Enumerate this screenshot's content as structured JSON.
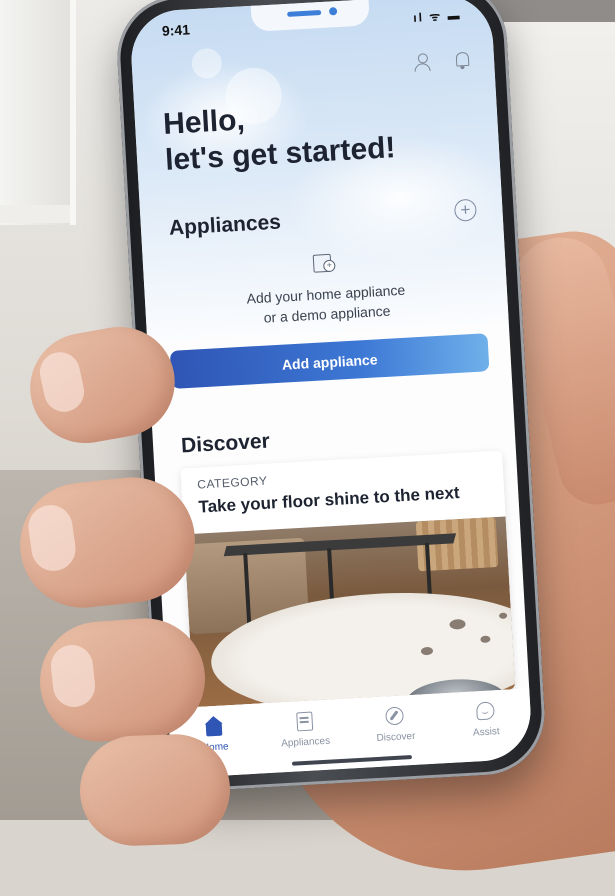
{
  "status": {
    "time": "9:41",
    "icons": "ıl ᯤ ▬"
  },
  "greeting": {
    "line1": "Hello,",
    "line2": "let's get started!"
  },
  "appliances": {
    "title": "Appliances",
    "add_icon": "plus-circle-icon",
    "empty_line1": "Add your home appliance",
    "empty_line2": "or a demo appliance",
    "button_label": "Add appliance"
  },
  "discover": {
    "title": "Discover",
    "card": {
      "category": "CATEGORY",
      "title": "Take your floor shine to the next"
    }
  },
  "tabs": [
    {
      "label": "Home",
      "icon": "home-icon",
      "active": true
    },
    {
      "label": "Appliances",
      "icon": "appliance-icon",
      "active": false
    },
    {
      "label": "Discover",
      "icon": "compass-icon",
      "active": false
    },
    {
      "label": "Assist",
      "icon": "chat-smile-icon",
      "active": false
    }
  ],
  "colors": {
    "accent": "#2f55b5",
    "accent_light": "#6fb0ea",
    "text": "#1d2330",
    "muted": "#8a93a3"
  }
}
